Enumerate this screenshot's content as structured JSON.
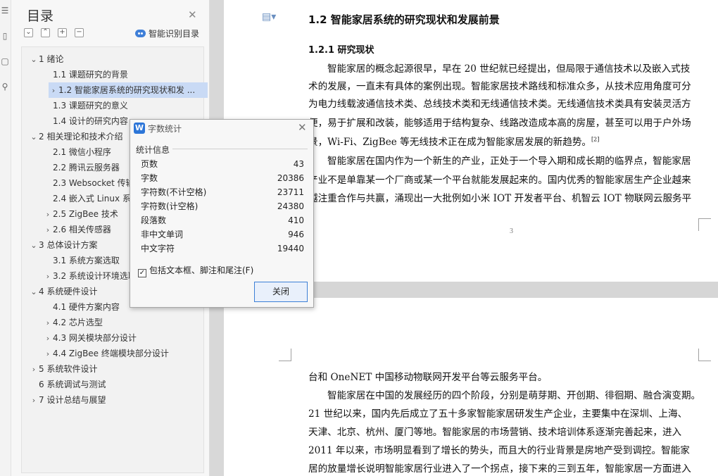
{
  "toc": {
    "title": "目录",
    "smart_label": "智能识别目录",
    "items": [
      {
        "text": "1  绪论",
        "arrow": "⌄"
      },
      {
        "text": "1.1  课题研究的背景",
        "arrow": ""
      },
      {
        "text": "1.2  智能家居系统的研究现状和发 ...",
        "arrow": "›"
      },
      {
        "text": "1.3  课题研究的意义",
        "arrow": ""
      },
      {
        "text": "1.4  设计的研究内容",
        "arrow": ""
      },
      {
        "text": "2  相关理论和技术介绍",
        "arrow": "⌄"
      },
      {
        "text": "2.1  微信小程序",
        "arrow": ""
      },
      {
        "text": "2.2  腾讯云服务器",
        "arrow": ""
      },
      {
        "text": "2.3 Websocket 传输",
        "arrow": ""
      },
      {
        "text": "2.4  嵌入式 Linux 系统",
        "arrow": ""
      },
      {
        "text": "2.5 ZigBee 技术",
        "arrow": "›"
      },
      {
        "text": "2.6  相关传感器",
        "arrow": "›"
      },
      {
        "text": "3  总体设计方案",
        "arrow": "⌄"
      },
      {
        "text": "3.1  系统方案选取",
        "arrow": ""
      },
      {
        "text": "3.2  系统设计环境选取",
        "arrow": "›"
      },
      {
        "text": "4  系统硬件设计",
        "arrow": "⌄"
      },
      {
        "text": "4.1  硬件方案内容",
        "arrow": ""
      },
      {
        "text": "4.2  芯片选型",
        "arrow": "›"
      },
      {
        "text": "4.3  网关模块部分设计",
        "arrow": "›"
      },
      {
        "text": "4.4 ZigBee 终端模块部分设计",
        "arrow": "›"
      },
      {
        "text": "5  系统软件设计",
        "arrow": "›"
      },
      {
        "text": "6  系统调试与测试",
        "arrow": ""
      },
      {
        "text": "7  设计总结与展望",
        "arrow": "›"
      }
    ]
  },
  "document": {
    "heading": "1.2  智能家居系统的研究现状和发展前景",
    "subheading": "1.2.1  研究现状",
    "page1_lines": [
      "智能家居的概念起源很早，早在 20 世纪就已经提出，但局限于通信技术以及嵌入式技",
      "术的发展，一直未有具体的案例出现。智能家居技术路线和标准众多，从技术应用角度可分",
      "为电力线载波通信技术类、总线技术类和无线通信技术类。无线通信技术类具有安装灵活方",
      "便，易于扩展和改装，能够适用于结构复杂、线路改造成本高的房屋，甚至可以用于户外场",
      "景，Wi-Fi、ZigBee 等无线技术正在成为智能家居发展的新趋势。",
      "智能家居在国内作为一个新生的产业，正处于一个导入期和成长期的临界点，智能家居",
      "产业不是单靠某一个厂商或某一个平台就能发展起来的。国内优秀的智能家居生产企业越来",
      "越注重合作与共赢，涌现出一大批例如小米 IOT 开发者平台、机智云 IOT 物联网云服务平"
    ],
    "citation": "[2]",
    "page_number": "3",
    "page2_lines": [
      "台和 OneNET 中国移动物联网开发平台等云服务平台。",
      "智能家居在中国的发展经历的四个阶段，分别是萌芽期、开创期、徘徊期、融合演变期。",
      "21 世纪以来，国内先后成立了五十多家智能家居研发生产企业，主要集中在深圳、上海、",
      "天津、北京、杭州、厦门等地。智能家居的市场营销、技术培训体系逐渐完善起来，进入",
      "2011 年以来，市场明显看到了增长的势头，而且大的行业背景是房地产受到调控。智能家",
      "居的放量增长说明智能家居行业进入了一个拐点，接下来的三到五年，智能家居一方面进入"
    ]
  },
  "dialog": {
    "title": "字数统计",
    "logo": "W",
    "section": "统计信息",
    "stats": [
      {
        "label": "页数",
        "value": "43"
      },
      {
        "label": "字数",
        "value": "20386"
      },
      {
        "label": "字符数(不计空格)",
        "value": "23711"
      },
      {
        "label": "字符数(计空格)",
        "value": "24380"
      },
      {
        "label": "段落数",
        "value": "410"
      },
      {
        "label": "非中文单词",
        "value": "946"
      },
      {
        "label": "中文字符",
        "value": "19440"
      }
    ],
    "checkbox_label": "包括文本框、脚注和尾注(F)",
    "checkbox_checked": true,
    "close_button": "关闭"
  },
  "colors": {
    "accent": "#3c7fd6",
    "selected_bg": "#c9daf5"
  }
}
